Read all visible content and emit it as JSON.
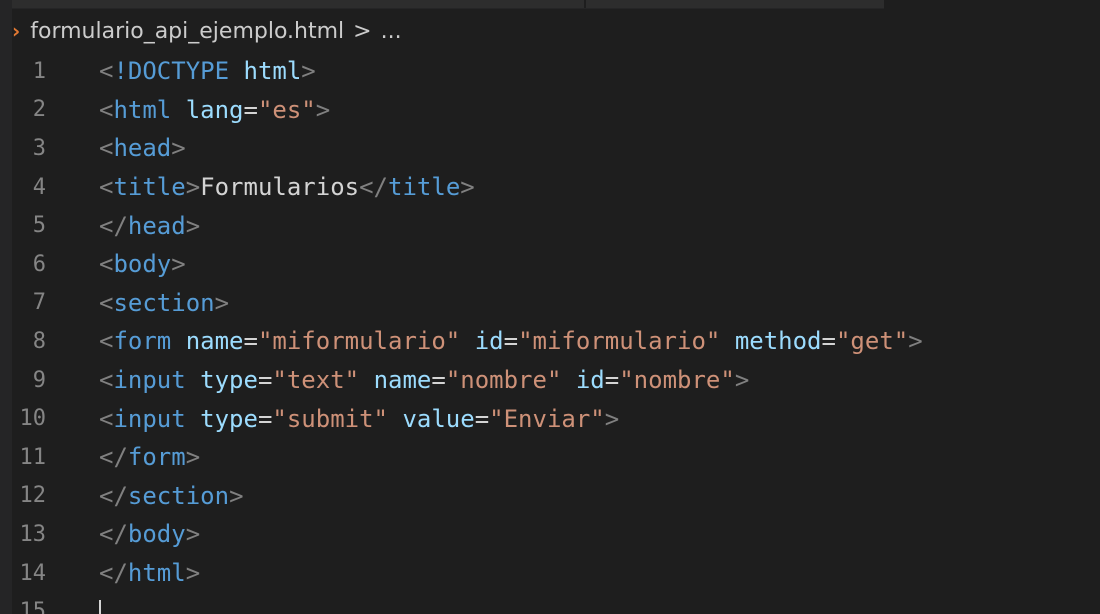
{
  "breadcrumb": {
    "file_icon": "›",
    "file_name": "formulario_api_ejemplo.html",
    "separator": ">",
    "ellipsis": "..."
  },
  "editor": {
    "lines": [
      {
        "number": "1",
        "tokens": [
          [
            "bracket",
            "<"
          ],
          [
            "tag",
            "!DOCTYPE"
          ],
          [
            "plain",
            " "
          ],
          [
            "attr",
            "html"
          ],
          [
            "bracket",
            ">"
          ]
        ]
      },
      {
        "number": "2",
        "tokens": [
          [
            "bracket",
            "<"
          ],
          [
            "tag",
            "html"
          ],
          [
            "plain",
            " "
          ],
          [
            "attr",
            "lang"
          ],
          [
            "plain",
            "="
          ],
          [
            "str",
            "\"es\""
          ],
          [
            "bracket",
            ">"
          ]
        ]
      },
      {
        "number": "3",
        "tokens": [
          [
            "bracket",
            "<"
          ],
          [
            "tag",
            "head"
          ],
          [
            "bracket",
            ">"
          ]
        ]
      },
      {
        "number": "4",
        "tokens": [
          [
            "bracket",
            "<"
          ],
          [
            "tag",
            "title"
          ],
          [
            "bracket",
            ">"
          ],
          [
            "text",
            "Formularios"
          ],
          [
            "bracket",
            "</"
          ],
          [
            "tag",
            "title"
          ],
          [
            "bracket",
            ">"
          ]
        ]
      },
      {
        "number": "5",
        "tokens": [
          [
            "bracket",
            "</"
          ],
          [
            "tag",
            "head"
          ],
          [
            "bracket",
            ">"
          ]
        ]
      },
      {
        "number": "6",
        "tokens": [
          [
            "bracket",
            "<"
          ],
          [
            "tag",
            "body"
          ],
          [
            "bracket",
            ">"
          ]
        ]
      },
      {
        "number": "7",
        "tokens": [
          [
            "bracket",
            "<"
          ],
          [
            "tag",
            "section"
          ],
          [
            "bracket",
            ">"
          ]
        ]
      },
      {
        "number": "8",
        "tokens": [
          [
            "bracket",
            "<"
          ],
          [
            "tag",
            "form"
          ],
          [
            "plain",
            " "
          ],
          [
            "attr",
            "name"
          ],
          [
            "plain",
            "="
          ],
          [
            "str",
            "\"miformulario\""
          ],
          [
            "plain",
            " "
          ],
          [
            "attr",
            "id"
          ],
          [
            "plain",
            "="
          ],
          [
            "str",
            "\"miformulario\""
          ],
          [
            "plain",
            " "
          ],
          [
            "attr",
            "method"
          ],
          [
            "plain",
            "="
          ],
          [
            "str",
            "\"get\""
          ],
          [
            "bracket",
            ">"
          ]
        ]
      },
      {
        "number": "9",
        "tokens": [
          [
            "bracket",
            "<"
          ],
          [
            "tag",
            "input"
          ],
          [
            "plain",
            " "
          ],
          [
            "attr",
            "type"
          ],
          [
            "plain",
            "="
          ],
          [
            "str",
            "\"text\""
          ],
          [
            "plain",
            " "
          ],
          [
            "attr",
            "name"
          ],
          [
            "plain",
            "="
          ],
          [
            "str",
            "\"nombre\""
          ],
          [
            "plain",
            " "
          ],
          [
            "attr",
            "id"
          ],
          [
            "plain",
            "="
          ],
          [
            "str",
            "\"nombre\""
          ],
          [
            "bracket",
            ">"
          ]
        ]
      },
      {
        "number": "10",
        "tokens": [
          [
            "bracket",
            "<"
          ],
          [
            "tag",
            "input"
          ],
          [
            "plain",
            " "
          ],
          [
            "attr",
            "type"
          ],
          [
            "plain",
            "="
          ],
          [
            "str",
            "\"submit\""
          ],
          [
            "plain",
            " "
          ],
          [
            "attr",
            "value"
          ],
          [
            "plain",
            "="
          ],
          [
            "str",
            "\"Enviar\""
          ],
          [
            "bracket",
            ">"
          ]
        ]
      },
      {
        "number": "11",
        "tokens": [
          [
            "bracket",
            "</"
          ],
          [
            "tag",
            "form"
          ],
          [
            "bracket",
            ">"
          ]
        ]
      },
      {
        "number": "12",
        "tokens": [
          [
            "bracket",
            "</"
          ],
          [
            "tag",
            "section"
          ],
          [
            "bracket",
            ">"
          ]
        ]
      },
      {
        "number": "13",
        "tokens": [
          [
            "bracket",
            "</"
          ],
          [
            "tag",
            "body"
          ],
          [
            "bracket",
            ">"
          ]
        ]
      },
      {
        "number": "14",
        "tokens": [
          [
            "bracket",
            "</"
          ],
          [
            "tag",
            "html"
          ],
          [
            "bracket",
            ">"
          ]
        ]
      },
      {
        "number": "15",
        "tokens": [],
        "cursor": true
      }
    ]
  },
  "colors": {
    "background": "#1e1e1e",
    "tag": "#569cd6",
    "attribute": "#9cdcfe",
    "string": "#ce9178",
    "bracket": "#808080",
    "text": "#d4d4d4",
    "line_number": "#858585",
    "file_icon": "#e37933"
  }
}
